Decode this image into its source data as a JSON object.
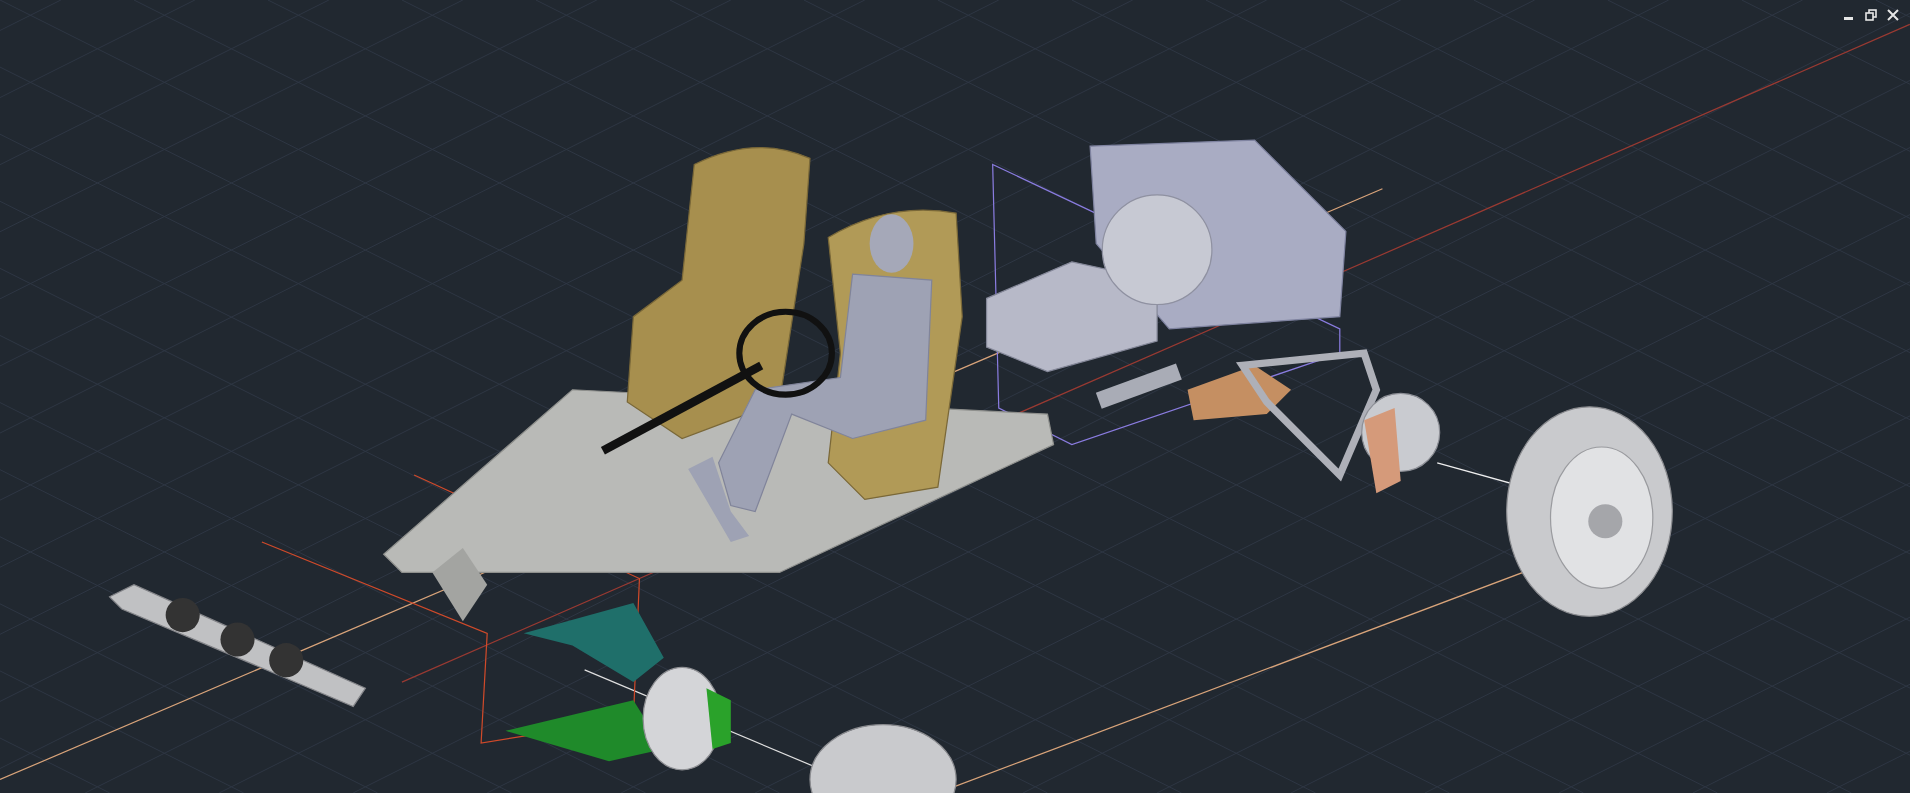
{
  "window_controls": [
    {
      "kind": "minimize"
    },
    {
      "kind": "restore"
    },
    {
      "kind": "close"
    }
  ]
}
